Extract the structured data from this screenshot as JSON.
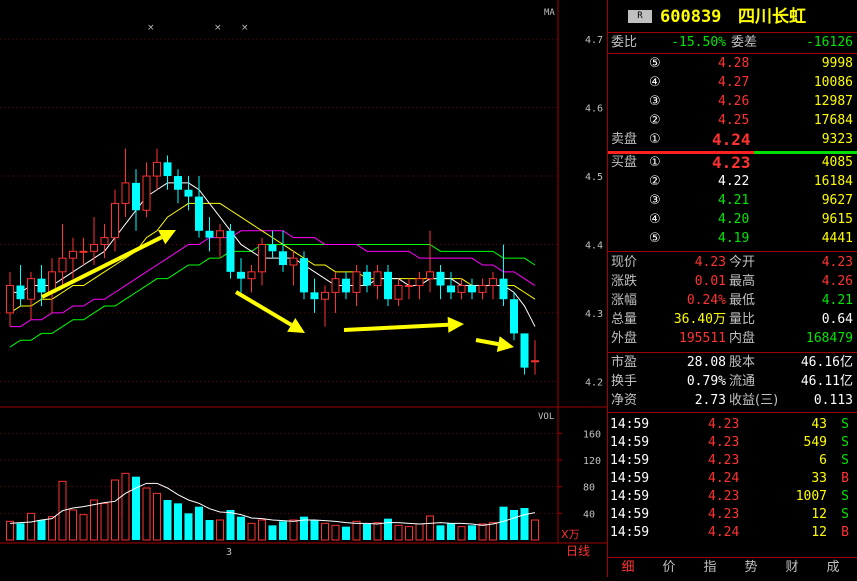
{
  "stock": {
    "badge": "R",
    "code": "600839",
    "name": "四川长虹"
  },
  "weibi": {
    "label": "委比",
    "value": "-15.50%",
    "diff_label": "委差",
    "diff_value": "-16126"
  },
  "sell_label": "卖盘",
  "buy_label": "买盘",
  "asks": [
    {
      "level": "⑤",
      "price": "4.28",
      "vol": "9998"
    },
    {
      "level": "④",
      "price": "4.27",
      "vol": "10086"
    },
    {
      "level": "③",
      "price": "4.26",
      "vol": "12987"
    },
    {
      "level": "②",
      "price": "4.25",
      "vol": "17684"
    },
    {
      "level": "①",
      "price": "4.24",
      "vol": "9323"
    }
  ],
  "bids": [
    {
      "level": "①",
      "price": "4.23",
      "vol": "4085"
    },
    {
      "level": "②",
      "price": "4.22",
      "vol": "16184"
    },
    {
      "level": "③",
      "price": "4.21",
      "vol": "9627"
    },
    {
      "level": "④",
      "price": "4.20",
      "vol": "9615"
    },
    {
      "level": "⑤",
      "price": "4.19",
      "vol": "4441"
    }
  ],
  "quote": [
    {
      "l1": "现价",
      "v1": "4.23",
      "l2": "今开",
      "v2": "4.23"
    },
    {
      "l1": "涨跌",
      "v1": "0.01",
      "l2": "最高",
      "v2": "4.26"
    },
    {
      "l1": "涨幅",
      "v1": "0.24%",
      "l2": "最低",
      "v2": "4.21"
    },
    {
      "l1": "总量",
      "v1": "36.40万",
      "l2": "量比",
      "v2": "0.64"
    },
    {
      "l1": "外盘",
      "v1": "195511",
      "l2": "内盘",
      "v2": "168479"
    }
  ],
  "fundamentals": [
    {
      "l1": "市盈",
      "v1": "28.08",
      "l2": "股本",
      "v2": "46.16亿"
    },
    {
      "l1": "换手",
      "v1": "0.79%",
      "l2": "流通",
      "v2": "46.11亿"
    },
    {
      "l1": "净资",
      "v1": "2.73",
      "l2": "收益(三)",
      "v2": "0.113"
    }
  ],
  "ticks": [
    {
      "time": "14:59",
      "price": "4.23",
      "vol": "43",
      "side": "S"
    },
    {
      "time": "14:59",
      "price": "4.23",
      "vol": "549",
      "side": "S"
    },
    {
      "time": "14:59",
      "price": "4.23",
      "vol": "6",
      "side": "S"
    },
    {
      "time": "14:59",
      "price": "4.24",
      "vol": "33",
      "side": "B"
    },
    {
      "time": "14:59",
      "price": "4.23",
      "vol": "1007",
      "side": "S"
    },
    {
      "time": "14:59",
      "price": "4.23",
      "vol": "12",
      "side": "S"
    },
    {
      "time": "14:59",
      "price": "4.24",
      "vol": "12",
      "side": "B"
    }
  ],
  "tabs": [
    "细",
    "价",
    "指",
    "势",
    "财",
    "成"
  ],
  "chart_labels": {
    "ma": "MA",
    "vol": "VOL",
    "vol_unit": "X万",
    "period": "日线",
    "month": "3"
  },
  "price_axis": [
    "4.7",
    "4.6",
    "4.5",
    "4.4",
    "4.3",
    "4.2"
  ],
  "vol_axis": [
    "160",
    "120",
    "80",
    "40"
  ],
  "colors": {
    "up": "#ff3232",
    "down": "#00ffff",
    "ma5": "#ffffff",
    "ma10": "#ffff00",
    "ma20": "#ff00ff",
    "ma60": "#00ff00",
    "arrow": "#ffff00"
  },
  "chart_data": {
    "type": "candlestick",
    "ylim": [
      4.18,
      4.75
    ],
    "vol_ylim": [
      0,
      180
    ],
    "candles": [
      {
        "o": 4.3,
        "h": 4.36,
        "l": 4.28,
        "c": 4.34,
        "v": 28
      },
      {
        "o": 4.34,
        "h": 4.37,
        "l": 4.31,
        "c": 4.32,
        "v": 25
      },
      {
        "o": 4.32,
        "h": 4.36,
        "l": 4.29,
        "c": 4.35,
        "v": 40
      },
      {
        "o": 4.35,
        "h": 4.37,
        "l": 4.31,
        "c": 4.33,
        "v": 30
      },
      {
        "o": 4.33,
        "h": 4.38,
        "l": 4.3,
        "c": 4.36,
        "v": 35
      },
      {
        "o": 4.36,
        "h": 4.43,
        "l": 4.34,
        "c": 4.38,
        "v": 88
      },
      {
        "o": 4.38,
        "h": 4.41,
        "l": 4.35,
        "c": 4.39,
        "v": 45
      },
      {
        "o": 4.39,
        "h": 4.41,
        "l": 4.37,
        "c": 4.39,
        "v": 38
      },
      {
        "o": 4.39,
        "h": 4.44,
        "l": 4.37,
        "c": 4.4,
        "v": 60
      },
      {
        "o": 4.4,
        "h": 4.43,
        "l": 4.38,
        "c": 4.41,
        "v": 55
      },
      {
        "o": 4.41,
        "h": 4.48,
        "l": 4.39,
        "c": 4.46,
        "v": 90
      },
      {
        "o": 4.46,
        "h": 4.54,
        "l": 4.44,
        "c": 4.49,
        "v": 100
      },
      {
        "o": 4.49,
        "h": 4.51,
        "l": 4.42,
        "c": 4.45,
        "v": 95
      },
      {
        "o": 4.45,
        "h": 4.52,
        "l": 4.44,
        "c": 4.5,
        "v": 78
      },
      {
        "o": 4.5,
        "h": 4.54,
        "l": 4.48,
        "c": 4.52,
        "v": 70
      },
      {
        "o": 4.52,
        "h": 4.53,
        "l": 4.48,
        "c": 4.5,
        "v": 60
      },
      {
        "o": 4.5,
        "h": 4.51,
        "l": 4.46,
        "c": 4.48,
        "v": 55
      },
      {
        "o": 4.48,
        "h": 4.5,
        "l": 4.45,
        "c": 4.47,
        "v": 40
      },
      {
        "o": 4.47,
        "h": 4.5,
        "l": 4.41,
        "c": 4.42,
        "v": 50
      },
      {
        "o": 4.42,
        "h": 4.44,
        "l": 4.39,
        "c": 4.41,
        "v": 30
      },
      {
        "o": 4.41,
        "h": 4.43,
        "l": 4.38,
        "c": 4.42,
        "v": 30
      },
      {
        "o": 4.42,
        "h": 4.43,
        "l": 4.35,
        "c": 4.36,
        "v": 45
      },
      {
        "o": 4.36,
        "h": 4.38,
        "l": 4.33,
        "c": 4.35,
        "v": 35
      },
      {
        "o": 4.35,
        "h": 4.37,
        "l": 4.33,
        "c": 4.36,
        "v": 25
      },
      {
        "o": 4.36,
        "h": 4.41,
        "l": 4.34,
        "c": 4.4,
        "v": 30
      },
      {
        "o": 4.4,
        "h": 4.42,
        "l": 4.38,
        "c": 4.39,
        "v": 22
      },
      {
        "o": 4.39,
        "h": 4.42,
        "l": 4.36,
        "c": 4.37,
        "v": 28
      },
      {
        "o": 4.37,
        "h": 4.39,
        "l": 4.34,
        "c": 4.38,
        "v": 30
      },
      {
        "o": 4.38,
        "h": 4.39,
        "l": 4.32,
        "c": 4.33,
        "v": 35
      },
      {
        "o": 4.33,
        "h": 4.35,
        "l": 4.3,
        "c": 4.32,
        "v": 30
      },
      {
        "o": 4.32,
        "h": 4.34,
        "l": 4.28,
        "c": 4.33,
        "v": 25
      },
      {
        "o": 4.33,
        "h": 4.36,
        "l": 4.3,
        "c": 4.35,
        "v": 22
      },
      {
        "o": 4.35,
        "h": 4.36,
        "l": 4.32,
        "c": 4.33,
        "v": 20
      },
      {
        "o": 4.33,
        "h": 4.37,
        "l": 4.31,
        "c": 4.36,
        "v": 28
      },
      {
        "o": 4.36,
        "h": 4.37,
        "l": 4.33,
        "c": 4.34,
        "v": 24
      },
      {
        "o": 4.34,
        "h": 4.37,
        "l": 4.32,
        "c": 4.36,
        "v": 26
      },
      {
        "o": 4.36,
        "h": 4.37,
        "l": 4.31,
        "c": 4.32,
        "v": 32
      },
      {
        "o": 4.32,
        "h": 4.35,
        "l": 4.31,
        "c": 4.34,
        "v": 22
      },
      {
        "o": 4.34,
        "h": 4.35,
        "l": 4.32,
        "c": 4.34,
        "v": 20
      },
      {
        "o": 4.34,
        "h": 4.36,
        "l": 4.32,
        "c": 4.35,
        "v": 24
      },
      {
        "o": 4.35,
        "h": 4.42,
        "l": 4.33,
        "c": 4.36,
        "v": 36
      },
      {
        "o": 4.36,
        "h": 4.37,
        "l": 4.32,
        "c": 4.34,
        "v": 22
      },
      {
        "o": 4.34,
        "h": 4.36,
        "l": 4.32,
        "c": 4.33,
        "v": 25
      },
      {
        "o": 4.33,
        "h": 4.35,
        "l": 4.32,
        "c": 4.34,
        "v": 20
      },
      {
        "o": 4.34,
        "h": 4.35,
        "l": 4.32,
        "c": 4.33,
        "v": 22
      },
      {
        "o": 4.33,
        "h": 4.35,
        "l": 4.32,
        "c": 4.34,
        "v": 24
      },
      {
        "o": 4.34,
        "h": 4.36,
        "l": 4.32,
        "c": 4.35,
        "v": 26
      },
      {
        "o": 4.35,
        "h": 4.4,
        "l": 4.31,
        "c": 4.32,
        "v": 50
      },
      {
        "o": 4.32,
        "h": 4.33,
        "l": 4.26,
        "c": 4.27,
        "v": 45
      },
      {
        "o": 4.27,
        "h": 4.27,
        "l": 4.21,
        "c": 4.22,
        "v": 48
      },
      {
        "o": 4.23,
        "h": 4.26,
        "l": 4.21,
        "c": 4.23,
        "v": 30
      }
    ],
    "ma5": [
      4.33,
      4.33,
      4.34,
      4.34,
      4.34,
      4.35,
      4.36,
      4.37,
      4.38,
      4.39,
      4.41,
      4.43,
      4.45,
      4.47,
      4.48,
      4.49,
      4.49,
      4.49,
      4.48,
      4.46,
      4.44,
      4.42,
      4.4,
      4.39,
      4.38,
      4.38,
      4.38,
      4.38,
      4.37,
      4.36,
      4.35,
      4.34,
      4.34,
      4.34,
      4.34,
      4.35,
      4.35,
      4.35,
      4.34,
      4.34,
      4.35,
      4.35,
      4.35,
      4.34,
      4.34,
      4.34,
      4.34,
      4.34,
      4.33,
      4.31,
      4.28
    ],
    "ma10": [
      4.3,
      4.31,
      4.31,
      4.32,
      4.32,
      4.33,
      4.34,
      4.34,
      4.35,
      4.36,
      4.37,
      4.38,
      4.39,
      4.41,
      4.42,
      4.44,
      4.45,
      4.46,
      4.46,
      4.46,
      4.46,
      4.45,
      4.44,
      4.43,
      4.42,
      4.41,
      4.4,
      4.39,
      4.38,
      4.37,
      4.37,
      4.36,
      4.36,
      4.36,
      4.35,
      4.35,
      4.35,
      4.35,
      4.35,
      4.35,
      4.35,
      4.35,
      4.35,
      4.35,
      4.34,
      4.34,
      4.34,
      4.34,
      4.34,
      4.33,
      4.32
    ],
    "ma20": [
      4.28,
      4.28,
      4.29,
      4.29,
      4.3,
      4.3,
      4.31,
      4.31,
      4.32,
      4.32,
      4.33,
      4.34,
      4.35,
      4.36,
      4.37,
      4.38,
      4.39,
      4.4,
      4.4,
      4.41,
      4.41,
      4.41,
      4.42,
      4.42,
      4.42,
      4.42,
      4.42,
      4.41,
      4.41,
      4.41,
      4.4,
      4.4,
      4.4,
      4.4,
      4.39,
      4.39,
      4.39,
      4.39,
      4.39,
      4.38,
      4.38,
      4.38,
      4.38,
      4.38,
      4.38,
      4.37,
      4.37,
      4.36,
      4.36,
      4.35,
      4.34
    ],
    "ma60": [
      4.25,
      4.26,
      4.26,
      4.27,
      4.27,
      4.28,
      4.29,
      4.29,
      4.3,
      4.31,
      4.31,
      4.32,
      4.33,
      4.34,
      4.35,
      4.35,
      4.36,
      4.37,
      4.37,
      4.38,
      4.38,
      4.39,
      4.39,
      4.39,
      4.4,
      4.4,
      4.4,
      4.4,
      4.4,
      4.4,
      4.4,
      4.4,
      4.4,
      4.4,
      4.4,
      4.4,
      4.4,
      4.4,
      4.4,
      4.4,
      4.4,
      4.39,
      4.39,
      4.39,
      4.39,
      4.39,
      4.39,
      4.38,
      4.38,
      4.38,
      4.37
    ],
    "vma5": [
      25,
      26,
      27,
      30,
      32,
      44,
      48,
      50,
      53,
      56,
      58,
      70,
      78,
      85,
      85,
      78,
      68,
      60,
      55,
      47,
      42,
      41,
      38,
      33,
      32,
      30,
      29,
      28,
      30,
      30,
      29,
      28,
      26,
      25,
      25,
      24,
      26,
      26,
      25,
      24,
      25,
      26,
      25,
      25,
      24,
      22,
      24,
      28,
      33,
      38,
      41
    ]
  }
}
